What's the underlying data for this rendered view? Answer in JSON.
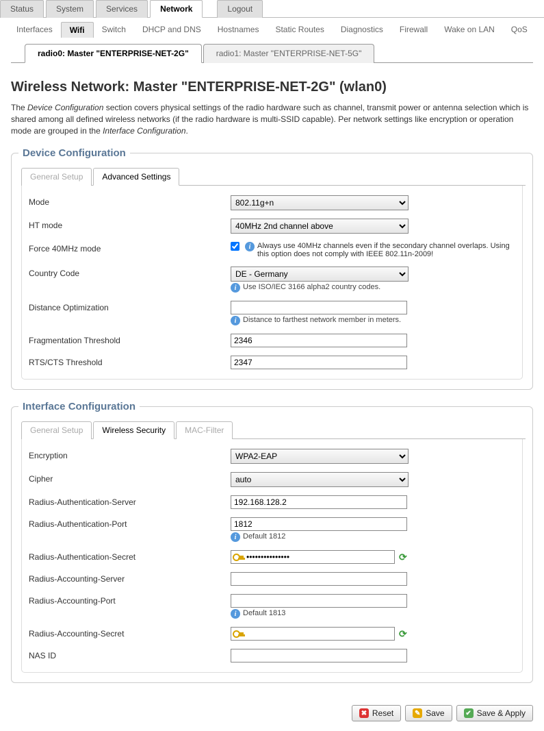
{
  "mainTabs": {
    "status": "Status",
    "system": "System",
    "services": "Services",
    "network": "Network",
    "logout": "Logout"
  },
  "subTabs": {
    "interfaces": "Interfaces",
    "wifi": "Wifi",
    "switch": "Switch",
    "dhcp": "DHCP and DNS",
    "hostnames": "Hostnames",
    "staticroutes": "Static Routes",
    "diagnostics": "Diagnostics",
    "firewall": "Firewall",
    "wol": "Wake on LAN",
    "qos": "QoS"
  },
  "radioTabs": {
    "r0": "radio0: Master \"ENTERPRISE-NET-2G\"",
    "r1": "radio1: Master \"ENTERPRISE-NET-5G\""
  },
  "pageTitle": "Wireless Network: Master \"ENTERPRISE-NET-2G\" (wlan0)",
  "descPart1": "The ",
  "descItalic1": "Device Configuration",
  "descPart2": " section covers physical settings of the radio hardware such as channel, transmit power or antenna selection which is shared among all defined wireless networks (if the radio hardware is multi-SSID capable). Per network settings like encryption or operation mode are grouped in the ",
  "descItalic2": "Interface Configuration",
  "descPart3": ".",
  "devConfig": {
    "legend": "Device Configuration",
    "tabs": {
      "general": "General Setup",
      "advanced": "Advanced Settings"
    },
    "labels": {
      "mode": "Mode",
      "htmode": "HT mode",
      "force40": "Force 40MHz mode",
      "country": "Country Code",
      "distance": "Distance Optimization",
      "frag": "Fragmentation Threshold",
      "rts": "RTS/CTS Threshold"
    },
    "values": {
      "mode": "802.11g+n",
      "htmode": "40MHz 2nd channel above",
      "country": "DE - Germany",
      "distance": "",
      "frag": "2346",
      "rts": "2347"
    },
    "hints": {
      "force40": "Always use 40MHz channels even if the secondary channel overlaps. Using this option does not comply with IEEE 802.11n-2009!",
      "country": "Use ISO/IEC 3166 alpha2 country codes.",
      "distance": "Distance to farthest network member in meters."
    }
  },
  "ifConfig": {
    "legend": "Interface Configuration",
    "tabs": {
      "general": "General Setup",
      "security": "Wireless Security",
      "mac": "MAC-Filter"
    },
    "labels": {
      "enc": "Encryption",
      "cipher": "Cipher",
      "authserver": "Radius-Authentication-Server",
      "authport": "Radius-Authentication-Port",
      "authsecret": "Radius-Authentication-Secret",
      "acctserver": "Radius-Accounting-Server",
      "acctport": "Radius-Accounting-Port",
      "acctsecret": "Radius-Accounting-Secret",
      "nasid": "NAS ID"
    },
    "values": {
      "enc": "WPA2-EAP",
      "cipher": "auto",
      "authserver": "192.168.128.2",
      "authport": "1812",
      "authsecret": "●●●●●●●●●●●●●●●",
      "acctserver": "",
      "acctport": "",
      "acctsecret": "",
      "nasid": ""
    },
    "hints": {
      "authport": "Default 1812",
      "acctport": "Default 1813"
    }
  },
  "actions": {
    "reset": "Reset",
    "save": "Save",
    "apply": "Save & Apply"
  }
}
